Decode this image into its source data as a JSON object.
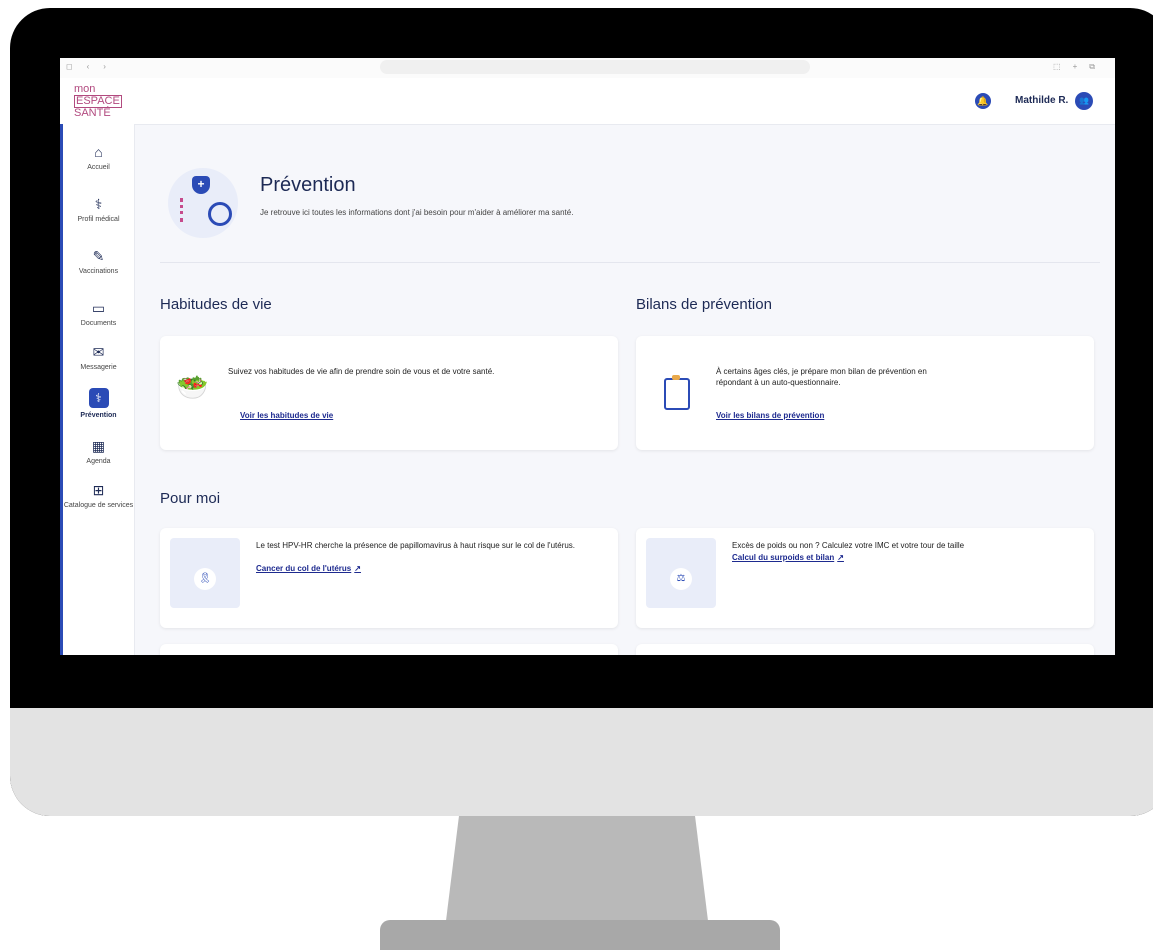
{
  "app": {
    "logo_lines": [
      "mon",
      "ESPACE",
      "SANTÉ"
    ],
    "user_name": "Mathilde R.",
    "bell_glyph": "🔔",
    "avatar_glyph": "👥"
  },
  "sidebar": {
    "items": [
      {
        "label": "Accueil",
        "icon": "home-icon",
        "glyph": "⌂"
      },
      {
        "label": "Profil médical",
        "icon": "profile-icon",
        "glyph": "⚕"
      },
      {
        "label": "Vaccinations",
        "icon": "syringe-icon",
        "glyph": "✎"
      },
      {
        "label": "Documents",
        "icon": "folder-icon",
        "glyph": "▭"
      },
      {
        "label": "Messagerie",
        "icon": "envelope-icon",
        "glyph": "✉"
      },
      {
        "label": "Prévention",
        "icon": "stethoscope-icon",
        "glyph": "⚕"
      },
      {
        "label": "Agenda",
        "icon": "calendar-icon",
        "glyph": "▦"
      },
      {
        "label": "Catalogue de services",
        "icon": "grid-icon",
        "glyph": "⊞"
      }
    ]
  },
  "main": {
    "title": "Prévention",
    "subtitle": "Je retrouve ici toutes les informations dont j'ai besoin pour m'aider à améliorer ma santé.",
    "hero_shield_glyph": "+",
    "sections": {
      "habitudes": {
        "title": "Habitudes de vie",
        "text": "Suivez vos habitudes de vie afin de prendre soin de vous et de votre santé.",
        "link": "Voir les habitudes de vie",
        "emoji": "🥗"
      },
      "bilans": {
        "title": "Bilans de prévention",
        "text": "À certains âges clés, je prépare mon bilan de prévention en répondant à un auto-questionnaire.",
        "link": "Voir les bilans de prévention"
      },
      "pour_moi": {
        "title": "Pour moi",
        "cards": [
          {
            "text": "Le test HPV-HR cherche la présence de papillomavirus à haut risque sur le col de l'utérus.",
            "link": "Cancer du col de l'utérus",
            "ext_glyph": "↗",
            "icon_glyph": "🎗"
          },
          {
            "text": "Excès de poids ou non ? Calculez votre IMC et votre tour de taille",
            "link": "Calcul du surpoids et bilan",
            "ext_glyph": "↗",
            "icon_glyph": "⚖"
          }
        ]
      }
    }
  }
}
